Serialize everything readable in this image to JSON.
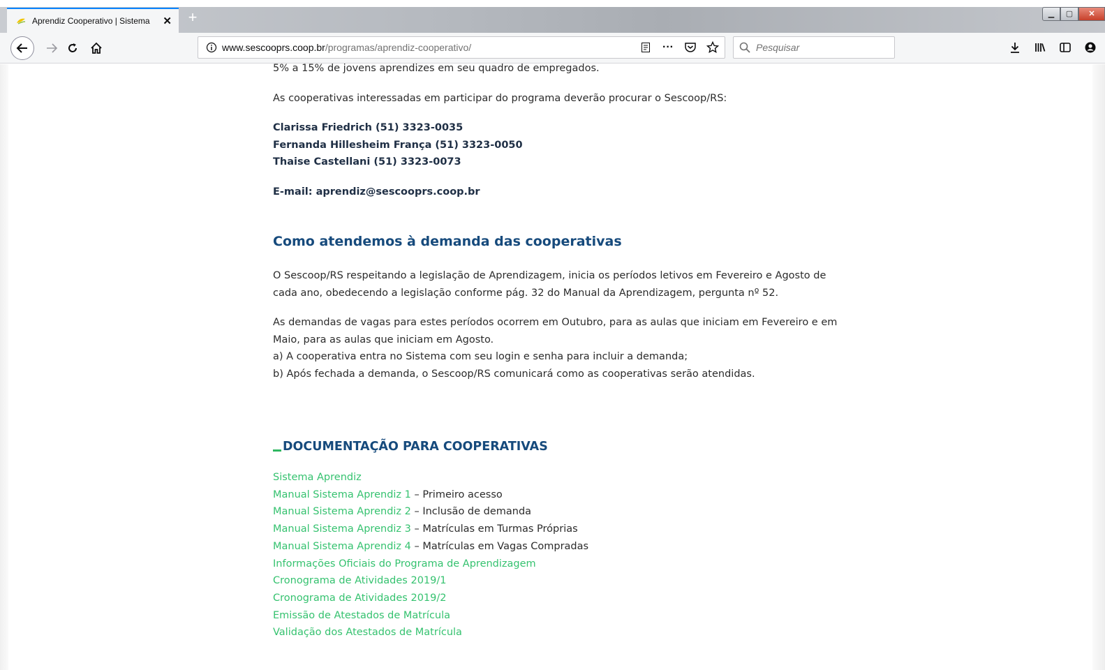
{
  "browser": {
    "tab_title": "Aprendiz Cooperativo | Sistema",
    "url_host": "www.sescooprs.coop.br",
    "url_path": "/programas/aprendiz-cooperativo/",
    "search_placeholder": "Pesquisar",
    "new_tab_label": "+"
  },
  "content": {
    "intro_tail": "5% a 15% de jovens aprendizes em seu quadro de empregados.",
    "contact_intro": "As cooperativas interessadas em participar do programa deverão procurar o Sescoop/RS:",
    "contacts": [
      "Clarissa Friedrich (51) 3323-0035",
      "Fernanda Hillesheim França (51) 3323-0050",
      "Thaise Castellani (51) 3323-0073"
    ],
    "email": "E-mail: aprendiz@sescooprs.coop.br",
    "section_title": "Como atendemos à demanda das cooperativas",
    "para1_line1": "O Sescoop/RS respeitando a legislação de Aprendizagem, inicia os períodos letivos em Fevereiro e Agosto de",
    "para1_line2": "cada ano, obedecendo a legislação conforme pág. 32 do Manual da Aprendizagem, pergunta nº 52.",
    "para2_line1": "As demandas de vagas para estes períodos ocorrem em Outubro, para as aulas que iniciam em Fevereiro e em",
    "para2_line2": "Maio, para as aulas que iniciam em Agosto.",
    "para2_line3": "a) A cooperativa entra no Sistema com seu login e senha para incluir a demanda;",
    "para2_line4": "b) Após fechada a demanda, o Sescoop/RS comunicará como as cooperativas serão atendidas.",
    "doc_title": "DOCUMENTAÇÃO PARA COOPERATIVAS",
    "doc_links": [
      {
        "link": "Sistema Aprendiz",
        "desc": ""
      },
      {
        "link": "Manual Sistema Aprendiz 1",
        "desc": " – Primeiro acesso"
      },
      {
        "link": "Manual Sistema Aprendiz 2",
        "desc": " – Inclusão de demanda"
      },
      {
        "link": "Manual Sistema Aprendiz 3",
        "desc": " – Matrículas em Turmas Próprias"
      },
      {
        "link": "Manual Sistema Aprendiz 4",
        "desc": " – Matrículas em Vagas Compradas"
      },
      {
        "link": "Informações Oficiais do Programa de Aprendizagem",
        "desc": ""
      },
      {
        "link": "Cronograma de Atividades 2019/1",
        "desc": ""
      },
      {
        "link": "Cronograma de Atividades 2019/2",
        "desc": ""
      },
      {
        "link": "Emissão de Atestados de Matrícula",
        "desc": ""
      },
      {
        "link": "Validação dos Atestados de Matrícula",
        "desc": ""
      }
    ]
  },
  "colors": {
    "heading": "#164a7c",
    "link": "#35c26f",
    "accent_tab": "#0a84ff"
  }
}
